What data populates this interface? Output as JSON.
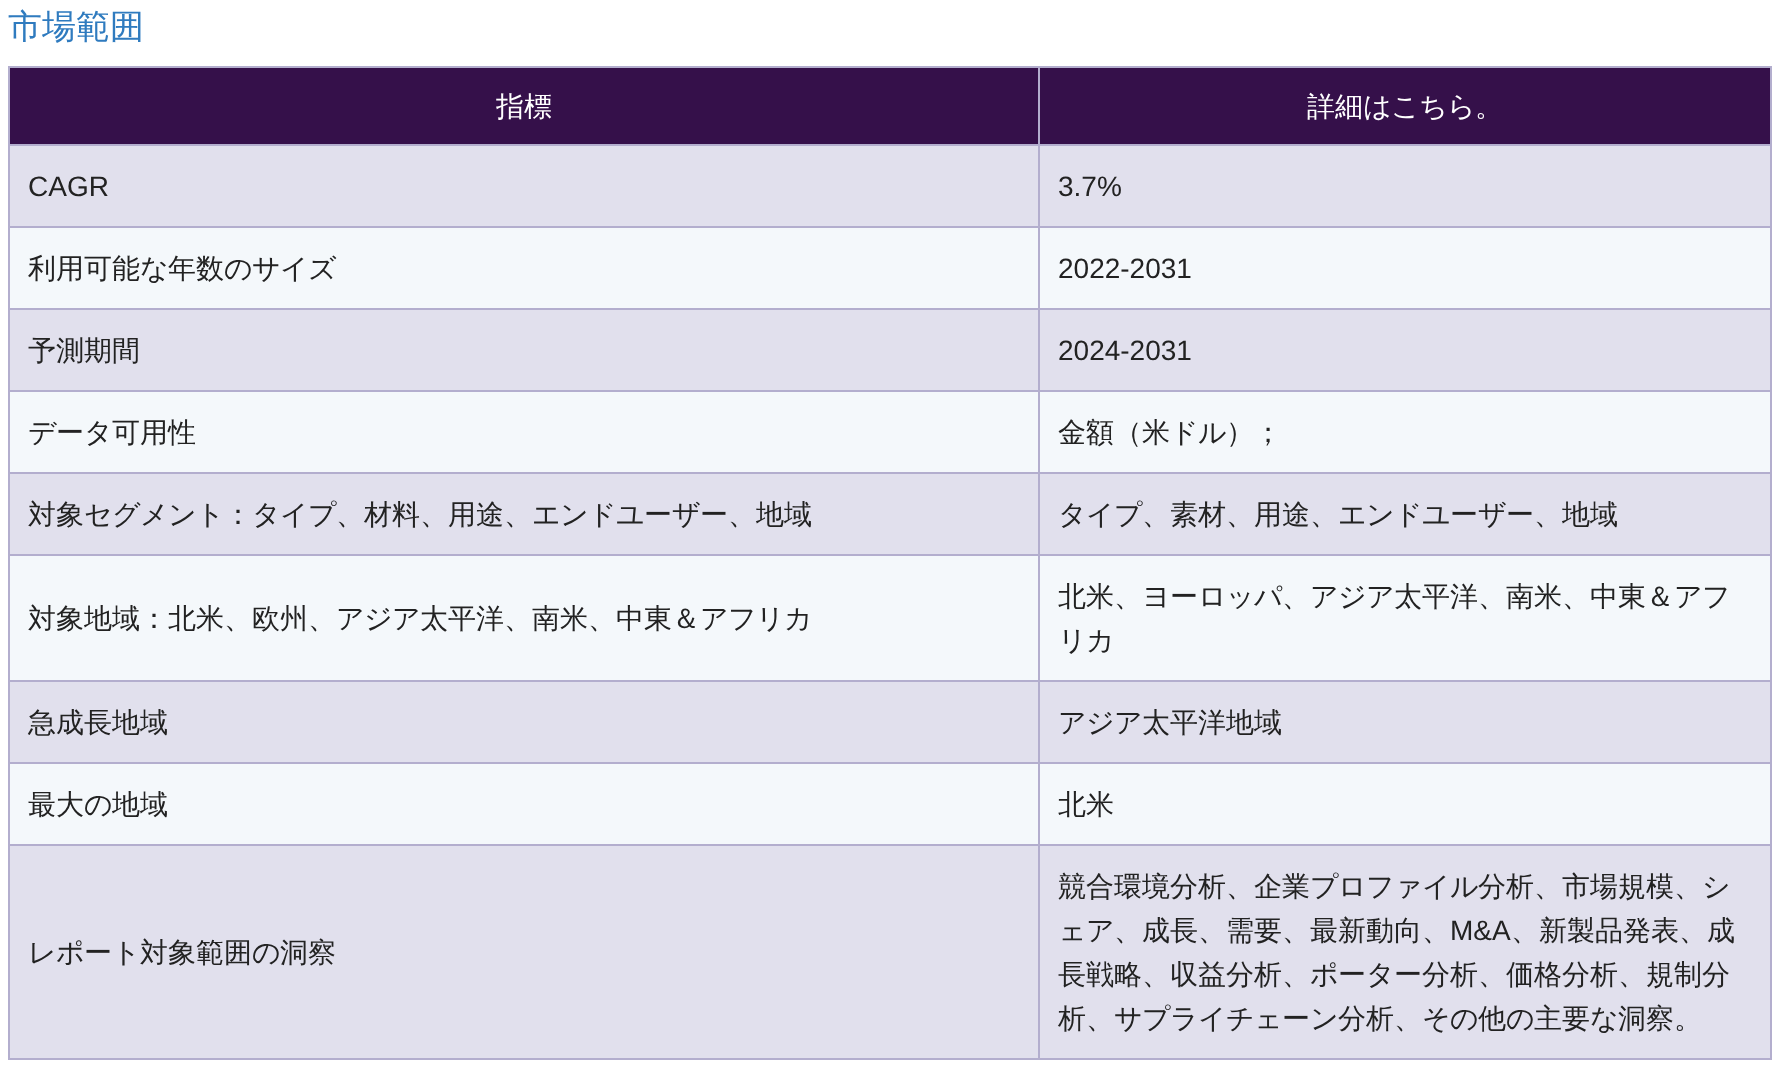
{
  "title": "市場範囲",
  "table": {
    "columns": [
      "指標",
      "詳細はこちら。"
    ],
    "rows": [
      [
        "CAGR",
        "3.7%"
      ],
      [
        "利用可能な年数のサイズ",
        "2022-2031"
      ],
      [
        "予測期間",
        "2024-2031"
      ],
      [
        "データ可用性",
        "金額（米ドル）；"
      ],
      [
        "対象セグメント：タイプ、材料、用途、エンドユーザー、地域",
        "タイプ、素材、用途、エンドユーザー、地域"
      ],
      [
        "対象地域：北米、欧州、アジア太平洋、南米、中東＆アフリカ",
        "北米、ヨーロッパ、アジア太平洋、南米、中東＆アフリカ"
      ],
      [
        "急成長地域",
        "アジア太平洋地域"
      ],
      [
        "最大の地域",
        "北米"
      ],
      [
        "レポート対象範囲の洞察",
        "競合環境分析、企業プロファイル分析、市場規模、シェア、成長、需要、最新動向、M&A、新製品発表、成長戦略、収益分析、ポーター分析、価格分析、規制分析、サプライチェーン分析、その他の主要な洞察。"
      ]
    ]
  }
}
